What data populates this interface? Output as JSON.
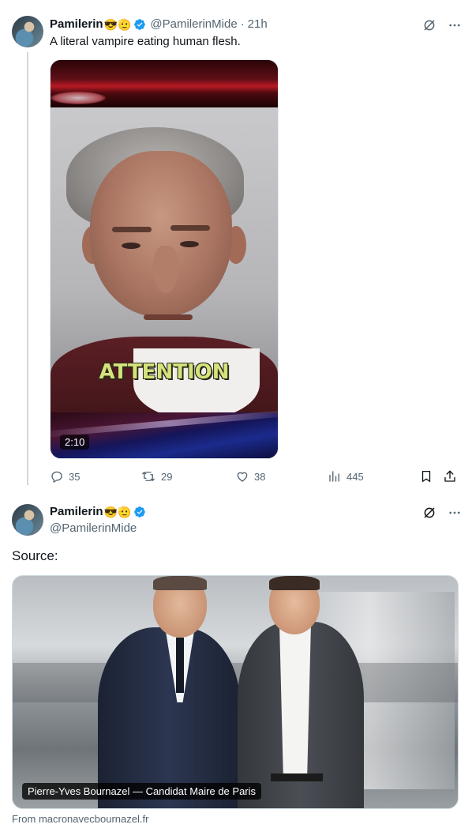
{
  "tweet1": {
    "display_name": "Pamilerin",
    "emojis": "😎🫡",
    "handle": "@PamilerinMide",
    "separator": "·",
    "time": "21h",
    "text": "A literal vampire eating human flesh.",
    "video": {
      "duration": "2:10",
      "overlay_caption": "ATTENTION"
    },
    "actions": {
      "replies": "35",
      "reposts": "29",
      "likes": "38",
      "views": "445"
    }
  },
  "tweet2": {
    "display_name": "Pamilerin",
    "emojis": "😎🫡",
    "handle": "@PamilerinMide",
    "text": "Source:",
    "card": {
      "caption": "Pierre-Yves Bournazel — Candidat Maire de Paris",
      "domain_line": "From macronavecbournazel.fr"
    }
  },
  "icons": {
    "verified": "verified-badge-icon",
    "grok": "grok-icon",
    "more": "more-icon",
    "reply": "reply-icon",
    "repost": "repost-icon",
    "like": "like-icon",
    "views": "views-icon",
    "bookmark": "bookmark-icon",
    "share": "share-icon"
  },
  "colors": {
    "verified_blue": "#1d9bf0",
    "secondary_text": "#536471",
    "primary_text": "#0f1419",
    "thread_line": "#cfd9de"
  }
}
